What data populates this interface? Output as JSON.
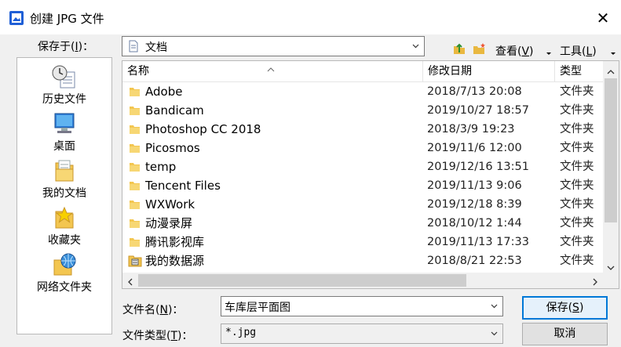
{
  "window": {
    "title": "创建 JPG 文件",
    "close_glyph": "✕"
  },
  "toolbar": {
    "save_in_label": "保存于(",
    "save_in_key": "I",
    "save_in_tail": ")：",
    "location": "文档",
    "view_label": "查看(",
    "view_key": "V",
    "view_tail": ")",
    "tools_label": "工具(",
    "tools_key": "L",
    "tools_tail": ")"
  },
  "places": [
    {
      "label": "历史文件",
      "icon": "history-icon"
    },
    {
      "label": "桌面",
      "icon": "desktop-icon"
    },
    {
      "label": "我的文档",
      "icon": "my-documents-icon"
    },
    {
      "label": "收藏夹",
      "icon": "favorites-icon"
    },
    {
      "label": "网络文件夹",
      "icon": "network-folder-icon"
    }
  ],
  "columns": {
    "name": "名称",
    "date": "修改日期",
    "type": "类型"
  },
  "files": [
    {
      "name": "Adobe",
      "date": "2018/7/13 20:08",
      "type": "文件夹"
    },
    {
      "name": "Bandicam",
      "date": "2019/10/27 18:57",
      "type": "文件夹"
    },
    {
      "name": "Photoshop CC 2018",
      "date": "2018/3/9 19:23",
      "type": "文件夹"
    },
    {
      "name": "Picosmos",
      "date": "2019/11/6 12:00",
      "type": "文件夹"
    },
    {
      "name": "temp",
      "date": "2019/12/16 13:51",
      "type": "文件夹"
    },
    {
      "name": "Tencent Files",
      "date": "2019/11/13 9:06",
      "type": "文件夹"
    },
    {
      "name": "WXWork",
      "date": "2019/12/18 8:39",
      "type": "文件夹"
    },
    {
      "name": "动漫录屏",
      "date": "2018/10/12 1:44",
      "type": "文件夹"
    },
    {
      "name": "腾讯影视库",
      "date": "2019/11/13 17:33",
      "type": "文件夹"
    },
    {
      "name": "我的数据源",
      "date": "2018/8/21 22:53",
      "type": "文件夹"
    }
  ],
  "filename": {
    "label": "文件名(",
    "key": "N",
    "tail": ")：",
    "value": "车库层平面图"
  },
  "filetype": {
    "label": "文件类型(",
    "key": "T",
    "tail": ")：",
    "value": "*.jpg"
  },
  "buttons": {
    "save": "保存(",
    "save_key": "S",
    "save_tail": ")",
    "cancel": "取消"
  },
  "colors": {
    "accent": "#0078d7",
    "folder": "#f3c650",
    "title_icon": "#1f5fd6"
  }
}
